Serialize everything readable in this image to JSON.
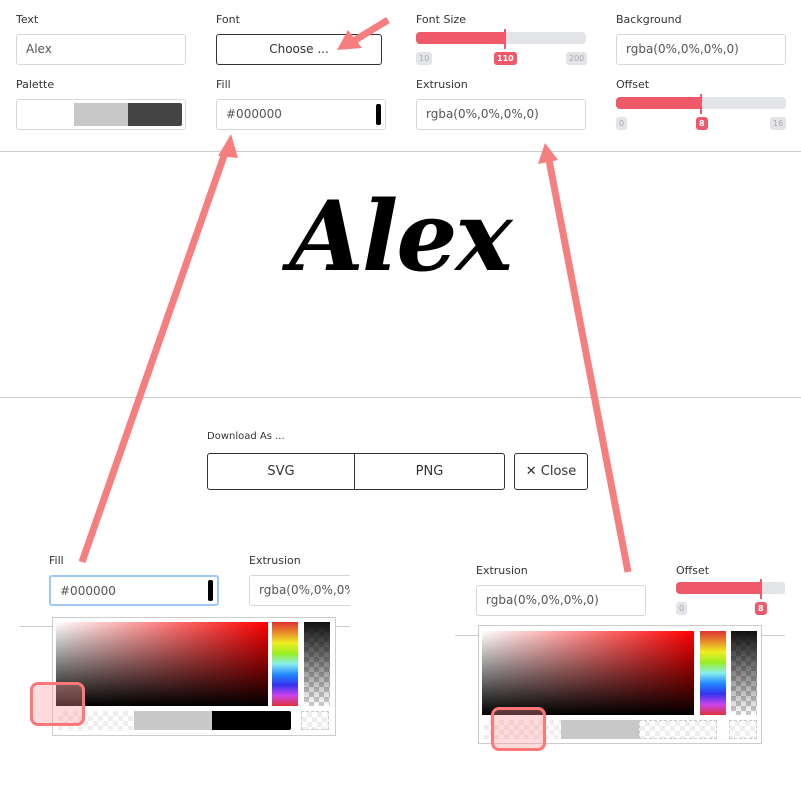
{
  "controls": {
    "text": {
      "label": "Text",
      "value": "Alex"
    },
    "font": {
      "label": "Font",
      "button": "Choose ..."
    },
    "font_size": {
      "label": "Font Size",
      "min": "10",
      "value": "110",
      "max": "200",
      "fraction": 0.526
    },
    "background": {
      "label": "Background",
      "value": "rgba(0%,0%,0%,0)"
    },
    "palette": {
      "label": "Palette",
      "colors": [
        "#ffffff",
        "#c8c8c8",
        "#444444"
      ]
    },
    "fill": {
      "label": "Fill",
      "value": "#000000",
      "swatch": "#000000"
    },
    "extrusion": {
      "label": "Extrusion",
      "value": "rgba(0%,0%,0%,0)"
    },
    "offset": {
      "label": "Offset",
      "min": "0",
      "value": "8",
      "max": "16",
      "fraction": 0.5
    }
  },
  "preview": {
    "text": "Alex"
  },
  "download": {
    "label": "Download As ...",
    "svg": "SVG",
    "png": "PNG",
    "close": "✕ Close"
  },
  "inset_left": {
    "fill_label": "Fill",
    "fill_value": "#000000",
    "extrusion_label": "Extrusion",
    "extrusion_value": "rgba(0%,0%,0%,"
  },
  "inset_right": {
    "extrusion_label": "Extrusion",
    "extrusion_value": "rgba(0%,0%,0%,0)",
    "offset_label": "Offset",
    "offset_min": "0",
    "offset_value": "8"
  },
  "colors": {
    "accent": "#ef5a6a",
    "arrow": "#f77e7e"
  }
}
